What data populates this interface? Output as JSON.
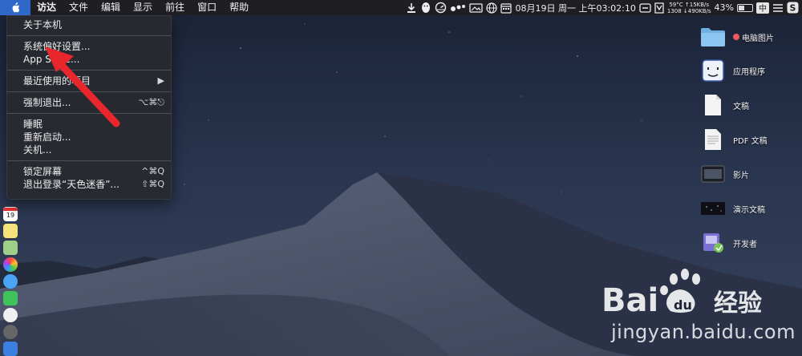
{
  "menubar": {
    "app_menus": [
      "访达",
      "文件",
      "编辑",
      "显示",
      "前往",
      "窗口",
      "帮助"
    ],
    "status": {
      "temp": "59°C",
      "net_up": "↑15KB/s",
      "net_down_left": "1308",
      "net_down": "↓490KB/s",
      "date": "08月19日",
      "weekday": "周一",
      "time": "上午03:02:10",
      "battery": "43%",
      "ime": "中",
      "battery_level": 0.43
    }
  },
  "apple_menu": {
    "items": [
      {
        "label": "关于本机",
        "shortcut": ""
      },
      {
        "label": "系统偏好设置...",
        "shortcut": ""
      },
      {
        "label": "App Store...",
        "shortcut": ""
      },
      {
        "label": "最近使用的项目",
        "shortcut": "▶"
      },
      {
        "label": "强制退出...",
        "shortcut": "⌥⌘⎋"
      },
      {
        "label": "睡眠",
        "shortcut": ""
      },
      {
        "label": "重新启动...",
        "shortcut": ""
      },
      {
        "label": "关机...",
        "shortcut": ""
      },
      {
        "label": "锁定屏幕",
        "shortcut": "^⌘Q"
      },
      {
        "label": "退出登录“天色迷香”...",
        "shortcut": "⇧⌘Q"
      }
    ]
  },
  "desktop_icons": [
    {
      "label": "电脑图片",
      "icon": "folder-icon",
      "tagged": true
    },
    {
      "label": "应用程序",
      "icon": "finder-app-icon",
      "tagged": false
    },
    {
      "label": "文稿",
      "icon": "document-icon",
      "tagged": false
    },
    {
      "label": "PDF 文稿",
      "icon": "pdf-document-icon",
      "tagged": false
    },
    {
      "label": "影片",
      "icon": "movie-icon",
      "tagged": false
    },
    {
      "label": "演示文稿",
      "icon": "presentation-icon",
      "tagged": false
    },
    {
      "label": "开发者",
      "icon": "developer-icon",
      "tagged": false
    }
  ],
  "dock": {
    "calendar_day": "19"
  },
  "watermark": {
    "brand": "Bai du 经验",
    "url": "jingyan.baidu.com"
  },
  "colors": {
    "menu_highlight": "#2f68c9",
    "arrow": "#e8262b",
    "tag_red": "#f05a5a"
  }
}
